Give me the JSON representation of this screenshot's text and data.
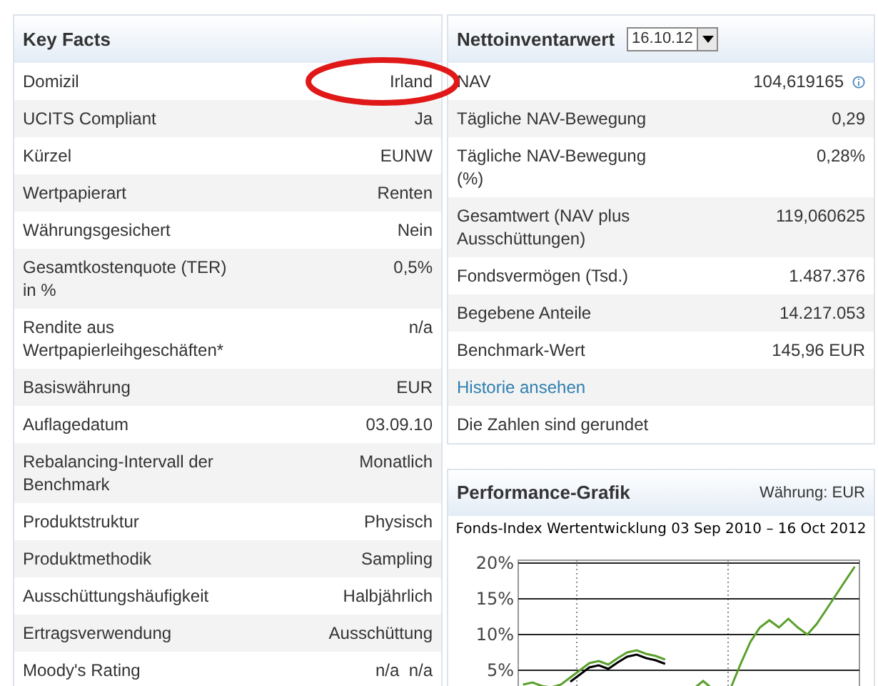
{
  "key_facts": {
    "title": "Key Facts",
    "rows": [
      {
        "label": "Domizil",
        "value": "Irland"
      },
      {
        "label": "UCITS Compliant",
        "value": "Ja"
      },
      {
        "label": "Kürzel",
        "value": "EUNW"
      },
      {
        "label": "Wertpapierart",
        "value": "Renten"
      },
      {
        "label": "Währungsgesichert",
        "value": "Nein"
      },
      {
        "label": "Gesamtkostenquote (TER) in %",
        "value": "0,5%"
      },
      {
        "label": "Rendite aus Wertpapierleihgeschäften*",
        "value": "n/a"
      },
      {
        "label": "Basiswährung",
        "value": "EUR"
      },
      {
        "label": "Auflagedatum",
        "value": "03.09.10"
      },
      {
        "label": "Rebalancing-Intervall der Benchmark",
        "value": "Monatlich"
      },
      {
        "label": "Produktstruktur",
        "value": "Physisch"
      },
      {
        "label": "Produktmethodik",
        "value": "Sampling"
      },
      {
        "label": "Ausschüttungshäufigkeit",
        "value": "Halbjährlich"
      },
      {
        "label": "Ertragsverwendung",
        "value": "Ausschüttung"
      },
      {
        "label": "Moody's Rating",
        "value": "n/a  n/a"
      }
    ]
  },
  "nav": {
    "title": "Nettoinventarwert",
    "date": "16.10.12",
    "rows": [
      {
        "kind": "value",
        "label": "NAV",
        "value": "104,619165",
        "info": true
      },
      {
        "kind": "value",
        "label": "Tägliche NAV-Bewegung",
        "value": "0,29"
      },
      {
        "kind": "value",
        "label": "Tägliche NAV-Bewegung (%)",
        "value": "0,28%"
      },
      {
        "kind": "value",
        "label": "Gesamtwert (NAV plus Ausschüttungen)",
        "value": "119,060625"
      },
      {
        "kind": "value",
        "label": "Fondsvermögen (Tsd.)",
        "value": "1.487.376"
      },
      {
        "kind": "value",
        "label": "Begebene Anteile",
        "value": "14.217.053"
      },
      {
        "kind": "value",
        "label": "Benchmark-Wert",
        "value": "145,96 EUR"
      },
      {
        "kind": "link",
        "label": "Historie ansehen"
      },
      {
        "kind": "note",
        "label": "Die Zahlen sind gerundet"
      }
    ]
  },
  "performance": {
    "title": "Performance-Grafik",
    "currency": "Währung: EUR",
    "chart_data": {
      "type": "line",
      "grid": true,
      "title": "Fonds-Index Wertentwicklung 03 Sep 2010 – 16 Oct 2012",
      "ylim": [
        1.6,
        20
      ],
      "yticks": [
        {
          "value": 5,
          "label": "5%"
        },
        {
          "value": 10,
          "label": "10%"
        },
        {
          "value": 15,
          "label": "15%"
        },
        {
          "value": 20,
          "label": "20%"
        }
      ],
      "series": [
        {
          "color": "#000000",
          "values": [
            null,
            null,
            null,
            null,
            null,
            3.4,
            4.4,
            5.4,
            5.7,
            5.2,
            6.1,
            6.9,
            7.2,
            6.7,
            6.4,
            5.9,
            null,
            null,
            null,
            null,
            null,
            null,
            null,
            null,
            null,
            null,
            null,
            null,
            null,
            null,
            null,
            null,
            null,
            null,
            null,
            null
          ]
        },
        {
          "color": "#5aa02c",
          "values": [
            3.0,
            3.3,
            2.8,
            2.6,
            3.0,
            4.0,
            5.0,
            6.0,
            6.3,
            5.8,
            6.7,
            7.5,
            7.8,
            7.3,
            7.0,
            6.5,
            null,
            null,
            2.4,
            3.5,
            2.4,
            null,
            2.8,
            6.0,
            9.0,
            11.0,
            12.0,
            11.0,
            12.2,
            11.0,
            10.0,
            11.5,
            13.5,
            15.5,
            17.5,
            19.5
          ]
        }
      ]
    }
  }
}
